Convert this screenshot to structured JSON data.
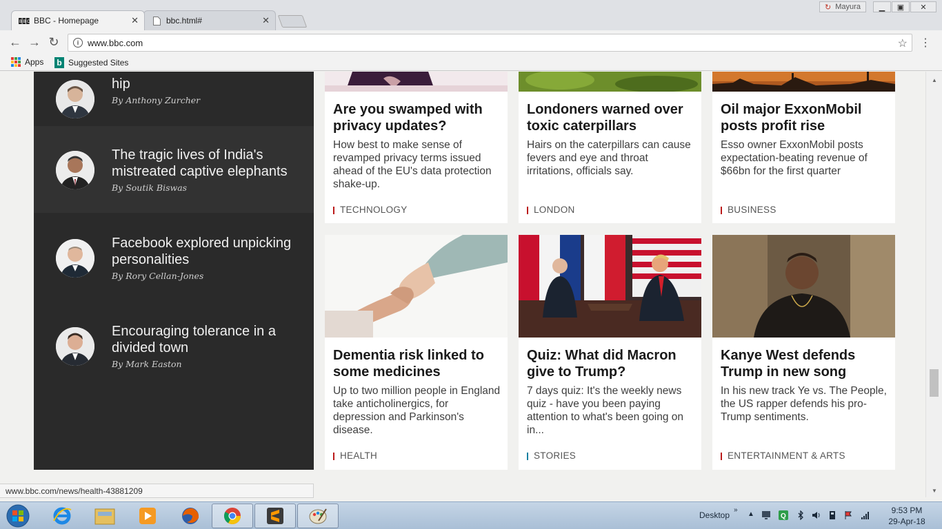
{
  "browser": {
    "tabs": [
      {
        "label": "BBC - Homepage",
        "close": "✕"
      },
      {
        "label": "bbc.html#",
        "close": "✕"
      }
    ],
    "profile_name": "Mayura",
    "url": "www.bbc.com",
    "bookmarks": [
      {
        "label": "Apps"
      },
      {
        "label": "Suggested Sites"
      }
    ],
    "status_url": "www.bbc.com/news/health-43881209"
  },
  "sidebar": {
    "items": [
      {
        "title": "hip",
        "author": "By Anthony Zurcher"
      },
      {
        "title": "The tragic lives of India's mistreated captive elephants",
        "author": "By Soutik Biswas"
      },
      {
        "title": "Facebook explored unpicking personalities",
        "author": "By Rory Cellan-Jones"
      },
      {
        "title": "Encouraging tolerance in a divided town",
        "author": "By Mark Easton"
      }
    ]
  },
  "cards": [
    {
      "headline": "Are you swamped with privacy updates?",
      "summary": "How best to make sense of revamped privacy terms issued ahead of the EU's data protection shake-up.",
      "tag": "TECHNOLOGY",
      "tag_color": "#bb1919"
    },
    {
      "headline": "Londoners warned over toxic caterpillars",
      "summary": "Hairs on the caterpillars can cause fevers and eye and throat irritations, officials say.",
      "tag": "LONDON",
      "tag_color": "#bb1919"
    },
    {
      "headline": "Oil major ExxonMobil posts profit rise",
      "summary": "Esso owner ExxonMobil posts expectation-beating revenue of $66bn for the first quarter",
      "tag": "BUSINESS",
      "tag_color": "#bb1919"
    },
    {
      "headline": "Dementia risk linked to some medicines",
      "summary": "Up to two million people in England take anticholinergics, for depression and Parkinson's disease.",
      "tag": "HEALTH",
      "tag_color": "#bb1919"
    },
    {
      "headline": "Quiz: What did Macron give to Trump?",
      "summary": "7 days quiz: It's the weekly news quiz - have you been paying attention to what's been going on in...",
      "tag": "STORIES",
      "tag_color": "#1380a1"
    },
    {
      "headline": "Kanye West defends Trump in new song",
      "summary": "In his new track Ye vs. The People, the US rapper defends his pro-Trump sentiments.",
      "tag": "ENTERTAINMENT & ARTS",
      "tag_color": "#bb1919"
    }
  ],
  "taskbar": {
    "tray_label": "Desktop",
    "time": "9:53 PM",
    "date": "29-Apr-18"
  }
}
